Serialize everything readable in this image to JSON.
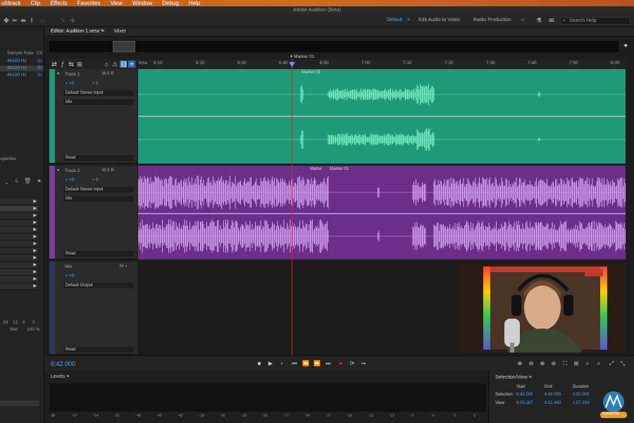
{
  "menubar": {
    "items": [
      "ultitrack",
      "Clip",
      "Effects",
      "Favorites",
      "View",
      "Window",
      "Debug",
      "Help"
    ]
  },
  "titlebar": {
    "title": "Adobe Audition (Beta)"
  },
  "workspaces": {
    "default": "Default",
    "edit_video": "Edit Audio to Video",
    "radio": "Radio Production",
    "more": "»"
  },
  "search": {
    "placeholder": "Search Help"
  },
  "files_panel": {
    "col_sample_rate": "Sample Rate",
    "col_ch": "Ch",
    "rows": [
      {
        "rate": "44100 Hz",
        "ch": "St"
      },
      {
        "rate": "44100 Hz",
        "ch": "St"
      },
      {
        "rate": "44100 Hz",
        "ch": "St"
      }
    ],
    "properties_label": "operties",
    "bottom_nums": [
      "18",
      "12",
      "6",
      "0"
    ],
    "wet_label": "Wet",
    "wet_value": "100 %"
  },
  "editor_tabs": {
    "editor": "Editor: Audition 1.sesx *",
    "mixer": "Mixer"
  },
  "ruler": {
    "unit": "hms",
    "ticks": [
      "6:10",
      "6:20",
      "6:30",
      "6:40",
      "6:50",
      "7:00",
      "7:10",
      "7:20",
      "7:30",
      "7:40",
      "7:50",
      "8:00"
    ],
    "marker": "Marker 01"
  },
  "tracks": [
    {
      "name": "Track 1",
      "volume": "+0",
      "pan": "0",
      "input": "Default Stereo Input",
      "output": "Mix",
      "mode": "Read",
      "color": "#1e9a78",
      "clip_marker": "Marker 01"
    },
    {
      "name": "Track 2",
      "volume": "+0",
      "pan": "0",
      "input": "Default Stereo Input",
      "output": "Mix",
      "mode": "Read",
      "color": "#7a3e9a",
      "clip_marker_a": "Marke",
      "clip_marker_b": "Marker 01"
    },
    {
      "name": "Mix",
      "volume": "+0",
      "output": "Default Output",
      "mode": "Read"
    }
  ],
  "track_buttons": "M  S  R",
  "transport": {
    "timecode": "6:42.000"
  },
  "levels": {
    "title": "Levels",
    "ticks": [
      "dB",
      "-57",
      "-54",
      "-51",
      "-48",
      "-45",
      "-42",
      "-39",
      "-36",
      "-33",
      "-30",
      "-27",
      "-24",
      "-21",
      "-18",
      "-15",
      "-12",
      "-9",
      "-6",
      "-3",
      "0"
    ]
  },
  "selection_view": {
    "title": "Selection/View",
    "headers": [
      "Start",
      "End",
      "Duration"
    ],
    "selection": {
      "label": "Selection",
      "start": "6:42.000",
      "end": "6:42.000",
      "duration": "0:00.000"
    },
    "view": {
      "label": "View",
      "start": "6:05.167",
      "end": "8:02.460",
      "duration": "1:57.293"
    }
  },
  "subscribe": {
    "label": "Subscribe"
  },
  "colors": {
    "track1": "#1e9a78",
    "track2": "#7a3e9a",
    "accent": "#4ea3ff",
    "playhead": "#d22222"
  }
}
